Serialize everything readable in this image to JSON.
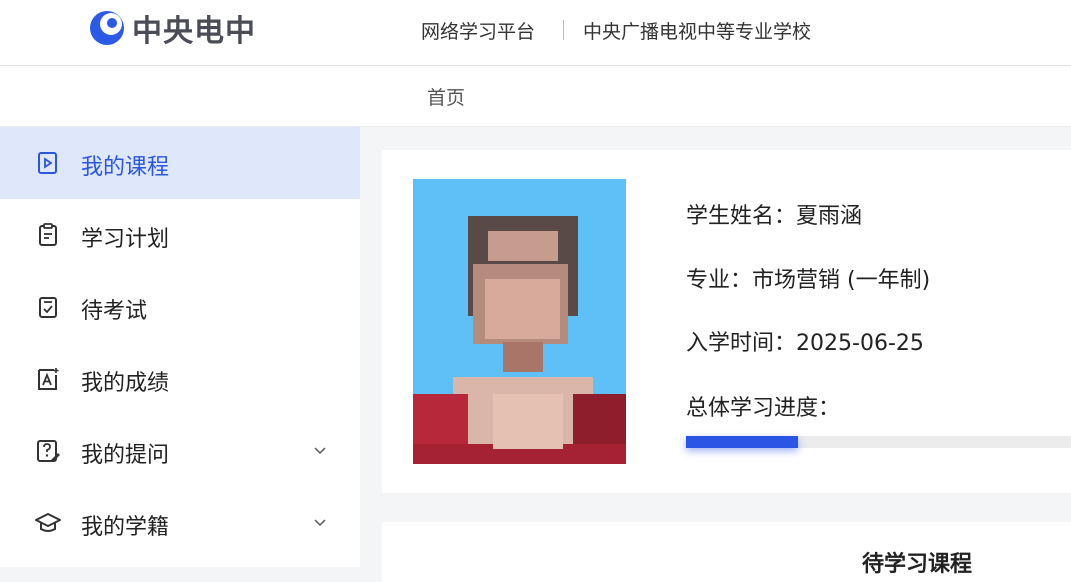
{
  "header": {
    "logo_text": "中央电中",
    "platform_name": "网络学习平台",
    "divider": "|",
    "school_name": "中央广播电视中等专业学校"
  },
  "nav": {
    "home": "首页"
  },
  "sidebar": {
    "items": [
      {
        "label": "我的课程",
        "icon": "play-video-icon",
        "active": true
      },
      {
        "label": "学习计划",
        "icon": "clipboard-icon",
        "active": false
      },
      {
        "label": "待考试",
        "icon": "check-document-icon",
        "active": false
      },
      {
        "label": "我的成绩",
        "icon": "grade-icon",
        "active": false
      },
      {
        "label": "我的提问",
        "icon": "question-edit-icon",
        "active": false,
        "expandable": true
      },
      {
        "label": "我的学籍",
        "icon": "graduation-cap-icon",
        "active": false,
        "expandable": true
      }
    ]
  },
  "student": {
    "name_label": "学生姓名：",
    "name": "夏雨涵",
    "major_label": "专业：",
    "major": "市场营销 (一年制)",
    "enroll_label": "入学时间：",
    "enroll_date": "2025-06-25",
    "progress_label": "总体学习进度：",
    "progress_fraction": 0.28
  },
  "pending_courses": {
    "title": "待学习课程"
  },
  "colors": {
    "accent": "#2a55e5",
    "active_bg": "#dfe7fb"
  }
}
